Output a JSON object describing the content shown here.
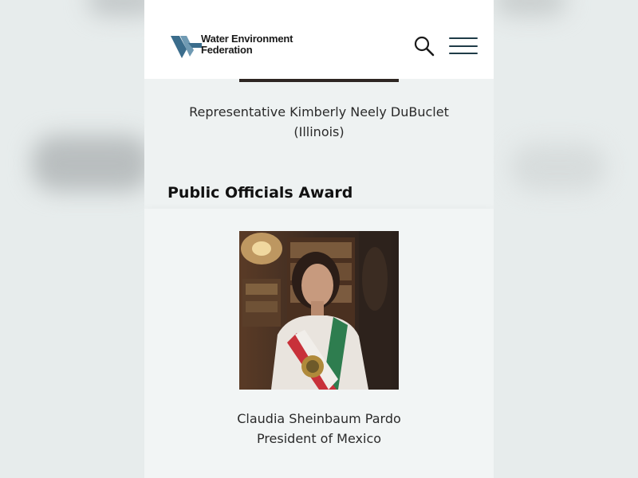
{
  "header": {
    "logo_line1": "Water Environment",
    "logo_line2": "Federation"
  },
  "award_1": {
    "name": "Representative Kimberly Neely DuBuclet",
    "detail": "(Illinois)"
  },
  "section": {
    "title": "Public Officials Award"
  },
  "award_2": {
    "name": "Claudia Sheinbaum Pardo",
    "detail": "President of Mexico"
  },
  "icons": {
    "search": "search-icon",
    "menu": "hamburger-menu-icon",
    "logo": "wef-logo-icon"
  },
  "colors": {
    "brand_blue": "#3b6d8c",
    "menu_navy": "#1f3b47",
    "page_bg": "#eef2f2"
  }
}
